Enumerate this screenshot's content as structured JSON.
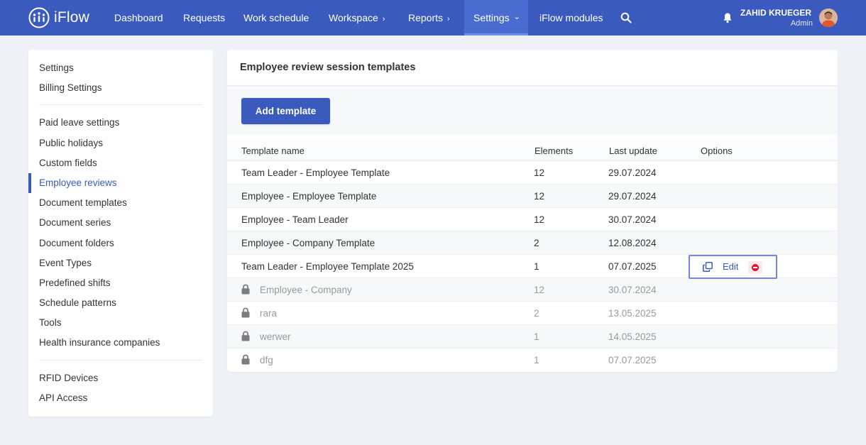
{
  "app": {
    "name": "iFlow"
  },
  "nav": {
    "items": [
      {
        "label": "Dashboard"
      },
      {
        "label": "Requests"
      },
      {
        "label": "Work schedule"
      },
      {
        "label": "Workspace",
        "chevron": "›"
      },
      {
        "label": "Reports",
        "chevron": "›"
      },
      {
        "label": "Settings",
        "chevron": "⌄"
      },
      {
        "label": "iFlow modules"
      }
    ],
    "icons": {
      "search": "search-icon",
      "notifications": "bell-icon"
    }
  },
  "user": {
    "name": "ZAHID KRUEGER",
    "role": "Admin"
  },
  "sidebar": {
    "items": [
      {
        "label": "Settings"
      },
      {
        "label": "Billing Settings"
      },
      {
        "label": "Paid leave settings"
      },
      {
        "label": "Public holidays"
      },
      {
        "label": "Custom fields"
      },
      {
        "label": "Employee reviews"
      },
      {
        "label": "Document templates"
      },
      {
        "label": "Document series"
      },
      {
        "label": "Document folders"
      },
      {
        "label": "Event Types"
      },
      {
        "label": "Predefined shifts"
      },
      {
        "label": "Schedule patterns"
      },
      {
        "label": "Tools"
      },
      {
        "label": "Health insurance companies"
      },
      {
        "label": "RFID Devices"
      },
      {
        "label": "API Access"
      }
    ],
    "active": "Employee reviews"
  },
  "main": {
    "title": "Employee review session templates",
    "add_button": "Add template",
    "table": {
      "columns": [
        "Template name",
        "Elements",
        "Last update",
        "Options"
      ],
      "rows": [
        {
          "name": "Team Leader - Employee Template",
          "elements": "12",
          "updated": "29.07.2024",
          "locked": false
        },
        {
          "name": "Employee - Employee Template",
          "elements": "12",
          "updated": "29.07.2024",
          "locked": false
        },
        {
          "name": "Employee - Team Leader",
          "elements": "12",
          "updated": "30.07.2024",
          "locked": false
        },
        {
          "name": "Employee - Company Template",
          "elements": "2",
          "updated": "12.08.2024",
          "locked": false
        },
        {
          "name": "Team Leader - Employee Template 2025",
          "elements": "1",
          "updated": "07.07.2025",
          "locked": false
        },
        {
          "name": "Employee - Company",
          "elements": "12",
          "updated": "30.07.2024",
          "locked": true
        },
        {
          "name": "rara",
          "elements": "2",
          "updated": "13.05.2025",
          "locked": true
        },
        {
          "name": "werwer",
          "elements": "1",
          "updated": "14.05.2025",
          "locked": true
        },
        {
          "name": "dfg",
          "elements": "1",
          "updated": "07.07.2025",
          "locked": true
        }
      ],
      "row_options": {
        "edit_label": "Edit",
        "icons": [
          "copy-icon",
          "delete-icon"
        ]
      }
    }
  },
  "colors": {
    "primary": "#3a5bbd",
    "highlight_border": "#7b83e6",
    "delete": "#e0132f"
  }
}
